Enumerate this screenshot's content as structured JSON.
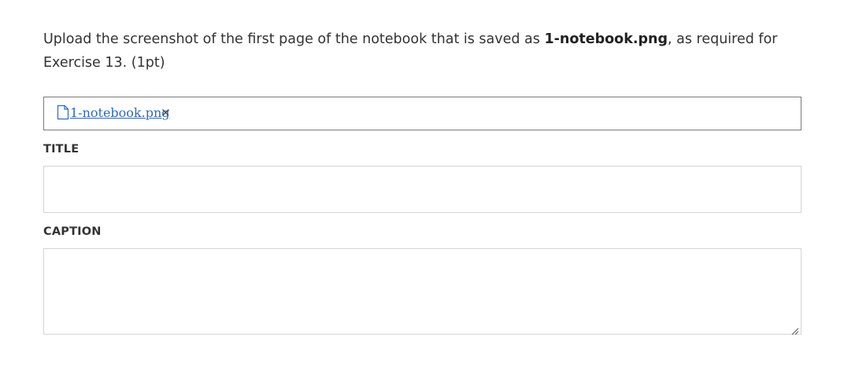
{
  "prompt": {
    "text_before": "Upload the screenshot of the first page of the notebook that is saved as ",
    "filename_bold": "1-notebook.png",
    "text_after": ", as required for Exercise 13. (1pt)"
  },
  "upload": {
    "file_name": "1-notebook.png",
    "remove_symbol": "×",
    "file_icon": "file-icon",
    "remove_icon": "close-icon"
  },
  "fields": {
    "title_label": "TITLE",
    "title_value": "",
    "caption_label": "CAPTION",
    "caption_value": ""
  },
  "colors": {
    "link": "#2a6bbf",
    "text": "#333333",
    "upload_border": "#7a7a7a",
    "input_border": "#d4d4d4"
  }
}
